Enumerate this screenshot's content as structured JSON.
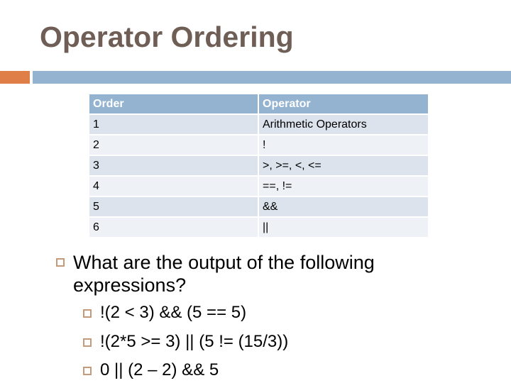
{
  "slide": {
    "title": "Operator Ordering",
    "colors": {
      "accent": "#e07e47",
      "primary": "#94b3d1",
      "title": "#6f5e55",
      "bullet": "#c49a7a"
    }
  },
  "table": {
    "headers": [
      "Order",
      "Operator"
    ],
    "rows": [
      [
        "1",
        "Arithmetic Operators"
      ],
      [
        "2",
        "!"
      ],
      [
        "3",
        ">, >=, <, <="
      ],
      [
        "4",
        "==, !="
      ],
      [
        "5",
        "&&"
      ],
      [
        "6",
        "||"
      ]
    ]
  },
  "content": {
    "question": "What are the output of the following expressions?",
    "expressions": [
      "!(2 < 3) && (5 == 5)",
      "!(2*5 >= 3) || (5 != (15/3))",
      "0 || (2 – 2) && 5"
    ]
  }
}
